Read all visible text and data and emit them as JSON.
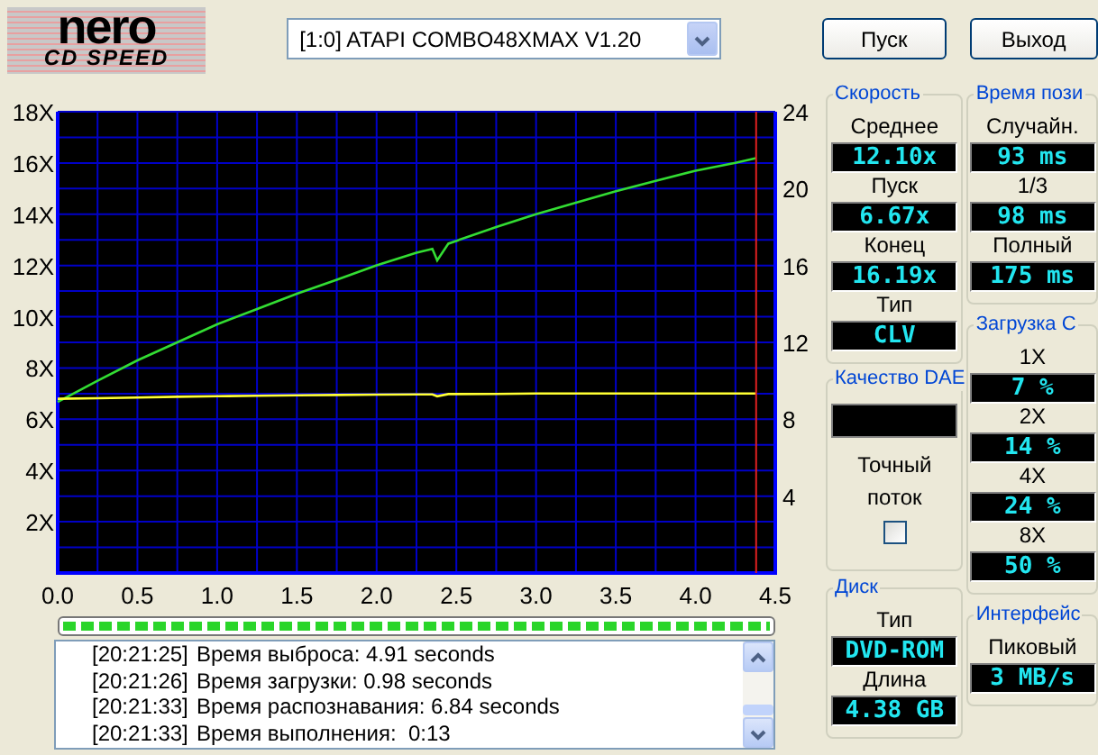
{
  "logo": {
    "line_1": "nero",
    "line_2": "CD SPEED"
  },
  "drive_select": {
    "value": "[1:0]  ATAPI COMBO48XMAX V1.20"
  },
  "buttons": [
    {
      "label": "Пуск"
    },
    {
      "label": "Выход"
    }
  ],
  "chart": {
    "chart_data": {
      "type": "line",
      "x": [
        0,
        0.25,
        0.5,
        0.75,
        1.0,
        1.25,
        1.5,
        1.75,
        2.0,
        2.25,
        2.35,
        2.38,
        2.45,
        2.75,
        3.0,
        3.25,
        3.5,
        3.75,
        4.0,
        4.25,
        4.38
      ],
      "series": [
        {
          "color": "#33dd33",
          "values": [
            6.67,
            7.5,
            8.3,
            9.0,
            9.7,
            10.3,
            10.9,
            11.45,
            12.0,
            12.5,
            12.65,
            12.2,
            12.85,
            13.5,
            14.0,
            14.45,
            14.9,
            15.3,
            15.7,
            16.0,
            16.19
          ]
        },
        {
          "color": "#ffff33",
          "values": [
            6.8,
            6.82,
            6.85,
            6.88,
            6.9,
            6.92,
            6.93,
            6.95,
            6.96,
            6.97,
            6.97,
            6.9,
            6.98,
            6.99,
            7.0,
            7.0,
            7.0,
            7.0,
            7.0,
            7.0,
            7.0
          ]
        }
      ],
      "xlim": [
        0,
        4.5
      ],
      "ylim": [
        0,
        18
      ],
      "xticks": [
        {
          "value": 0,
          "label": "0.0"
        },
        {
          "value": 0.5,
          "label": "0.5"
        },
        {
          "value": 1,
          "label": "1.0"
        },
        {
          "value": 1.5,
          "label": "1.5"
        },
        {
          "value": 2,
          "label": "2.0"
        },
        {
          "value": 2.5,
          "label": "2.5"
        },
        {
          "value": 3,
          "label": "3.0"
        },
        {
          "value": 3.5,
          "label": "3.5"
        },
        {
          "value": 4,
          "label": "4.0"
        },
        {
          "value": 4.5,
          "label": "4.5"
        }
      ],
      "yticks": [
        {
          "value": 2,
          "label": "2X"
        },
        {
          "value": 4,
          "label": "4X"
        },
        {
          "value": 6,
          "label": "6X"
        },
        {
          "value": 8,
          "label": "8X"
        },
        {
          "value": 10,
          "label": "10X"
        },
        {
          "value": 12,
          "label": "12X"
        },
        {
          "value": 14,
          "label": "14X"
        },
        {
          "value": 16,
          "label": "16X"
        },
        {
          "value": 18,
          "label": "18X"
        }
      ],
      "y2lim": [
        0,
        24
      ],
      "y2ticks": [
        4,
        8,
        12,
        16,
        20,
        24
      ],
      "grid": true,
      "ref_lines": [
        {
          "axis": "x",
          "value": 4.38,
          "color": "#e02020"
        }
      ]
    }
  },
  "progress": {
    "level": 1
  },
  "log": [
    {
      "time": "[20:21:25]",
      "message": "Время выброса: 4.91 seconds"
    },
    {
      "time": "[20:21:26]",
      "message": "Время загрузки: 0.98 seconds"
    },
    {
      "time": "[20:21:33]",
      "message": "Время распознавания: 6.84 seconds"
    },
    {
      "time": "[20:21:33]",
      "message": "Время выполнения:  0:13"
    }
  ],
  "panel_columns": [
    [
      {
        "kind": "readouts",
        "title": "Скорость",
        "fields": [
          {
            "label": "Среднее",
            "value": "12.10x"
          },
          {
            "label": "Пуск",
            "value": "6.67x"
          },
          {
            "label": "Конец",
            "value": "16.19x"
          },
          {
            "label": "Тип",
            "value": "CLV"
          }
        ]
      },
      {
        "kind": "dae",
        "title": "Качество DAE",
        "checkbox": {
          "label": "Точный поток",
          "checked": false
        }
      },
      {
        "kind": "readouts",
        "title": "Диск",
        "fields": [
          {
            "label": "Тип",
            "value": "DVD-ROM"
          },
          {
            "label": "Длина",
            "value": "4.38 GB"
          }
        ]
      }
    ],
    [
      {
        "kind": "readouts",
        "title": "Время пози",
        "fields": [
          {
            "label": "Случайн.",
            "value": "93 ms"
          },
          {
            "label": "1/3",
            "value": "98 ms"
          },
          {
            "label": "Полный",
            "value": "175 ms"
          }
        ]
      },
      {
        "kind": "readouts",
        "title": "Загрузка C",
        "fields": [
          {
            "label": "1X",
            "value": "7 %"
          },
          {
            "label": "2X",
            "value": "14 %"
          },
          {
            "label": "4X",
            "value": "24 %"
          },
          {
            "label": "8X",
            "value": "50 %"
          }
        ]
      },
      {
        "kind": "readouts",
        "title": "Интерфейс",
        "fields": [
          {
            "label": "Пиковый",
            "value": "3 MB/s"
          }
        ]
      }
    ]
  ]
}
